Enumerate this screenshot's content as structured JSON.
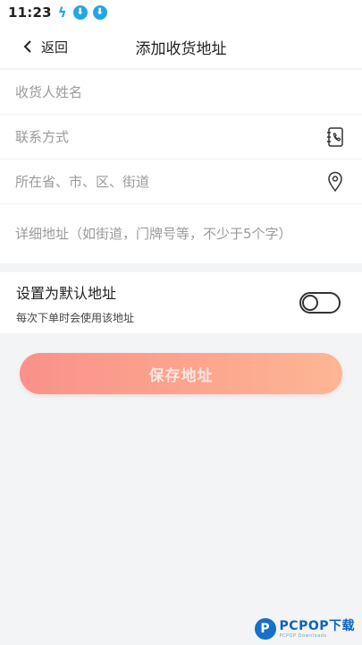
{
  "status_bar": {
    "time": "11:23",
    "icons": [
      "lightning-icon",
      "download-icon",
      "download-icon"
    ]
  },
  "header": {
    "back_label": "返回",
    "title": "添加收货地址"
  },
  "form": {
    "name_placeholder": "收货人姓名",
    "contact_placeholder": "联系方式",
    "region_placeholder": "所在省、市、区、街道",
    "detail_placeholder": "详细地址（如街道，门牌号等，不少于5个字）",
    "contact_icon": "contact-book-icon",
    "region_icon": "location-pin-icon"
  },
  "default_address": {
    "title": "设置为默认地址",
    "subtitle": "每次下单时会使用该地址",
    "enabled": false
  },
  "save_button": {
    "label": "保存地址"
  },
  "watermark": {
    "logo_letter": "P",
    "text": "PCPOP下载",
    "subtext": "PCPOP Downloads"
  },
  "colors": {
    "button_start": "#f9918a",
    "button_end": "#fdb695",
    "status_icon": "#22a6e6",
    "background": "#f3f4f6"
  }
}
